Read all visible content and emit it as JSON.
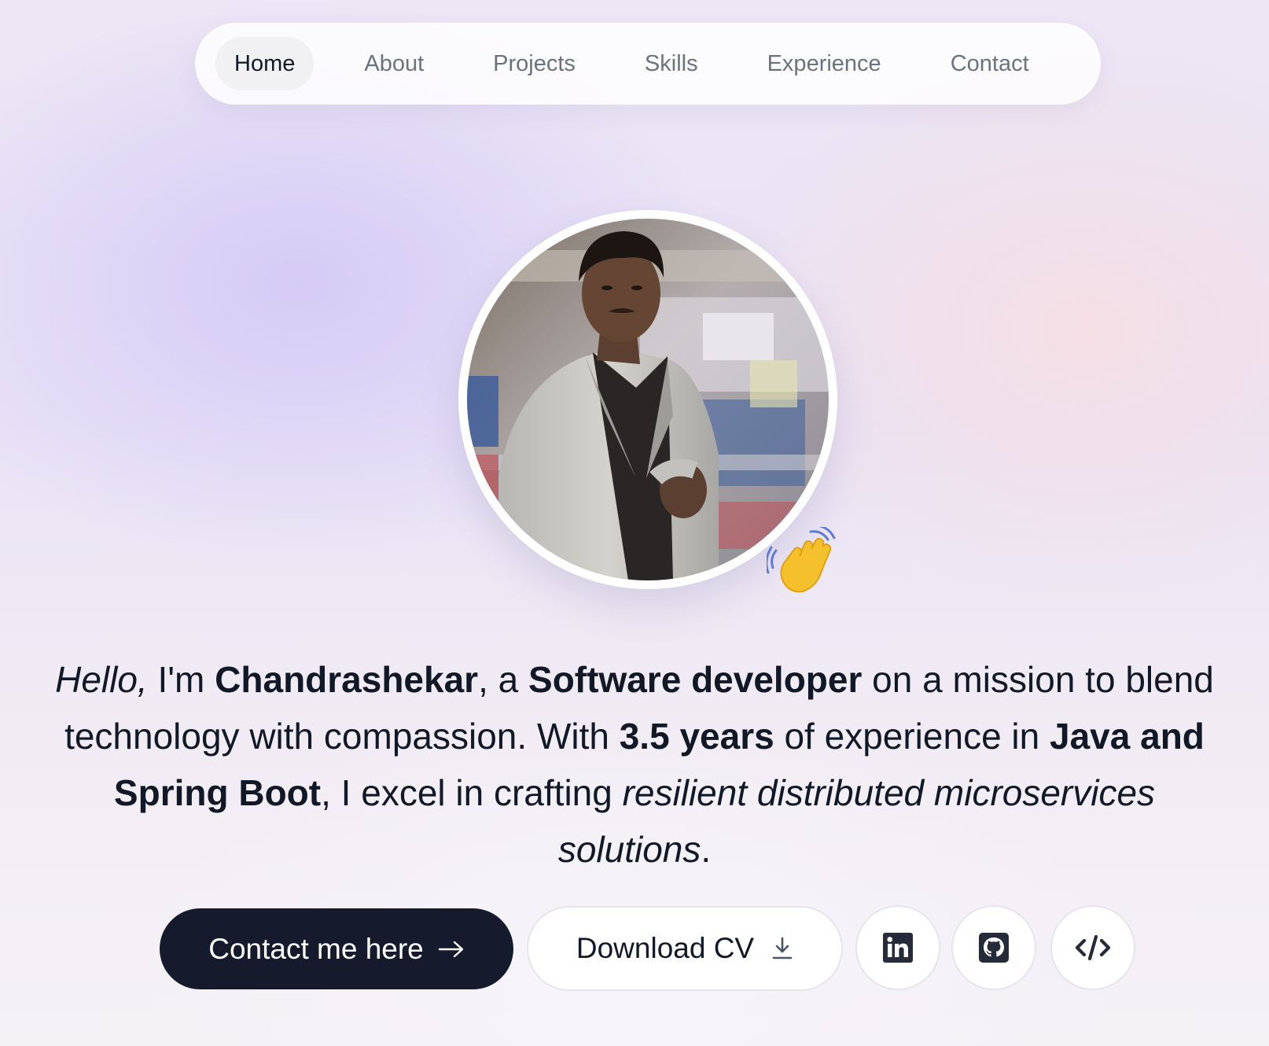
{
  "nav": {
    "items": [
      {
        "label": "Home",
        "active": true
      },
      {
        "label": "About",
        "active": false
      },
      {
        "label": "Projects",
        "active": false
      },
      {
        "label": "Skills",
        "active": false
      },
      {
        "label": "Experience",
        "active": false
      },
      {
        "label": "Contact",
        "active": false
      }
    ]
  },
  "hero": {
    "avatar_icon": "profile-photo",
    "badge_icon": "waving-hand-icon",
    "intro": {
      "hello": "Hello,",
      "im": " I'm ",
      "name": "Chandrashekar",
      "a": ", a ",
      "role": "Software developer",
      "mission": " on a mission to blend technology with compassion. With ",
      "years": "3.5 years",
      "experience_in": " of experience in ",
      "stack": "Java and Spring Boot",
      "excel": ", I excel in crafting ",
      "focus": "resilient distributed microservices solutions",
      "end": "."
    }
  },
  "actions": {
    "contact_label": "Contact me here",
    "contact_icon": "arrow-right-icon",
    "download_label": "Download CV",
    "download_icon": "download-icon",
    "social": [
      {
        "name": "linkedin",
        "icon": "linkedin-icon"
      },
      {
        "name": "github",
        "icon": "github-icon"
      },
      {
        "name": "code",
        "icon": "code-icon"
      }
    ]
  },
  "colors": {
    "primary_button": "#151b2c",
    "text": "#111827",
    "muted_text": "#6b7280",
    "active_pill": "#f1f1f4"
  }
}
